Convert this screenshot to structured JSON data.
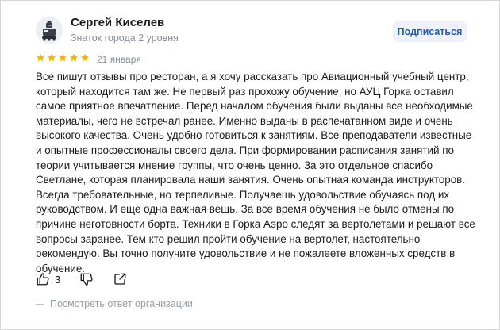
{
  "author": {
    "name": "Сергей Киселев",
    "level": "Знаток города 2 уровня",
    "avatar_icon": "robot-avatar-icon"
  },
  "subscribe_label": "Подписаться",
  "rating": {
    "value": 5,
    "max": 5,
    "color": "#f5b800"
  },
  "date": "21 января",
  "review_text": "Все пишут отзывы про ресторан, а я хочу рассказать про Авиационный учебный центр, который находится там же. Не первый раз прохожу обучение, но АУЦ Горка оставил самое приятное впечатление. Перед началом обучения были выданы все необходимые материалы, чего не встречал ранее. Именно выданы в распечатанном виде и очень высокого качества. Очень удобно готовиться к занятиям. Все преподаватели известные и опытные профессионалы своего дела. При формировании расписания занятий по теории учитывается мнение группы, что очень ценно. За это отдельное спасибо Светлане, которая планировала наши занятия. Очень опытная команда инструкторов. Всегда требовательные, но терпеливые. Получаешь удовольствие обучаясь под их руководством. И еще одна важная вещь. За все время обучения не было отмены по причине неготовности борта. Техники в Горка Аэро следят за вертолетами и решают все вопросы заранее. Тем кто решил пройти обучение на вертолет, настоятельно рекомендую. Вы точно получите удовольствие и не пожалеете вложенных средств в обучение.",
  "actions": {
    "likes": "3",
    "like_icon": "thumbs-up-icon",
    "dislike_icon": "thumbs-down-icon",
    "share_icon": "share-icon"
  },
  "org_reply_label": "Посмотреть ответ организации",
  "colors": {
    "accent": "#1f5fb0",
    "button_bg": "#eef2f8",
    "muted_text": "#8a8f98"
  }
}
